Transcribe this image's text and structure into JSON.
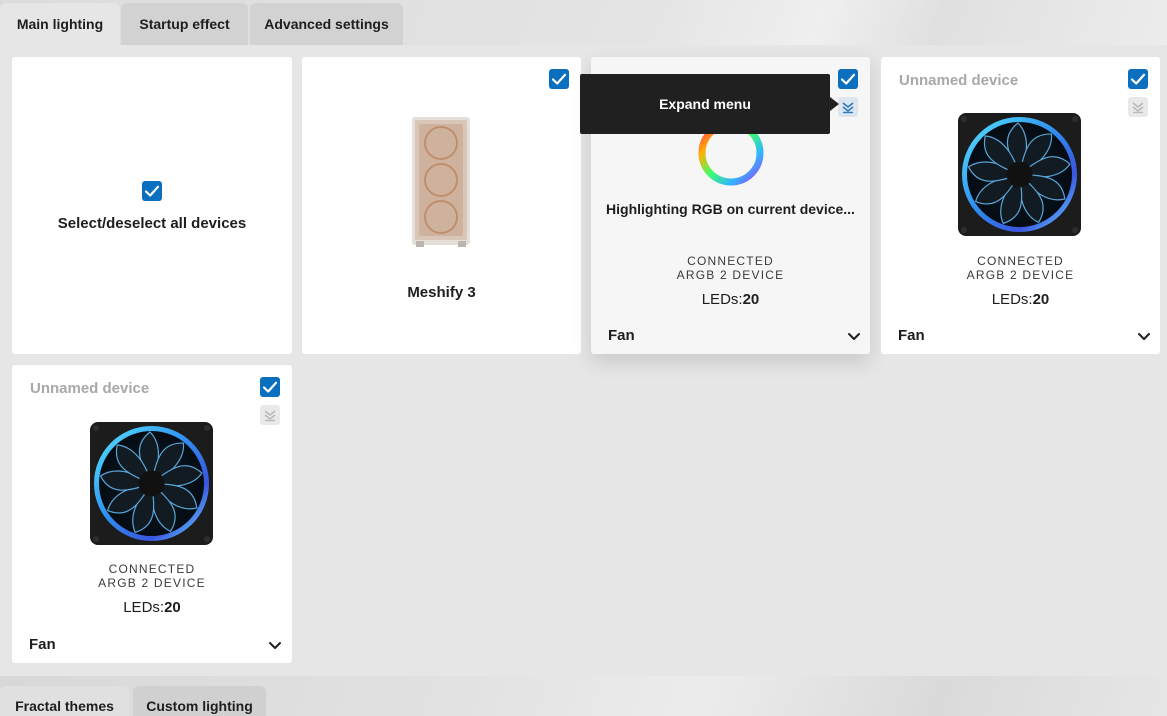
{
  "tabs": {
    "main_lighting": "Main lighting",
    "startup_effect": "Startup effect",
    "advanced_settings": "Advanced settings"
  },
  "select_all": {
    "label": "Select/deselect all devices",
    "checked": true
  },
  "devices": [
    {
      "name": "Meshify 3",
      "checked": true
    },
    {
      "checked": true,
      "highlight_text": "Highlighting RGB on current device...",
      "status_line1": "CONNECTED",
      "status_line2": "ARGB 2 DEVICE",
      "leds_label": "LEDs:",
      "leds_value": "20",
      "type": "Fan"
    },
    {
      "name": "Unnamed device",
      "checked": true,
      "status_line1": "CONNECTED",
      "status_line2": "ARGB 2 DEVICE",
      "leds_label": "LEDs:",
      "leds_value": "20",
      "type": "Fan"
    },
    {
      "name": "Unnamed device",
      "checked": true,
      "status_line1": "CONNECTED",
      "status_line2": "ARGB 2 DEVICE",
      "leds_label": "LEDs:",
      "leds_value": "20",
      "type": "Fan"
    }
  ],
  "tooltip": {
    "text": "Expand menu"
  },
  "bottom_tabs": {
    "fractal_themes": "Fractal themes",
    "custom_lighting": "Custom lighting"
  },
  "icons": {
    "checkbox": "checkmark-icon",
    "expand": "expand-menu-icon",
    "chevron": "chevron-down-icon",
    "fan": "fan-icon",
    "case": "pc-case-icon",
    "rgb_ring": "rgb-ring-icon"
  },
  "colors": {
    "accent": "#0b6fbf",
    "tooltip_bg": "#202020",
    "muted_title": "#a8a8a8"
  }
}
